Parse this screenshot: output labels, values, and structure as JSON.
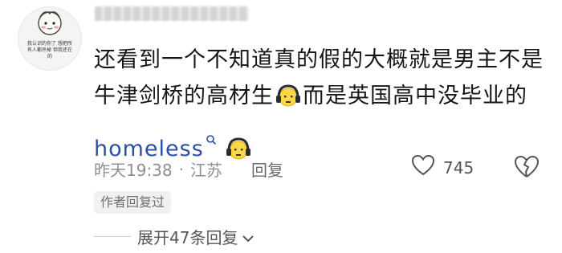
{
  "avatar": {
    "caption": "我认识的你了 想把所有人都杀掉 但我还在的"
  },
  "comment": {
    "text_before": "还看到一个不知道真的假的大概就是男主不是牛津剑桥的高材生",
    "text_middle": "而是英国高中没毕业的",
    "keyword": "homeless",
    "emoji_name": "headphone-face-emoji"
  },
  "meta": {
    "time": "昨天19:38",
    "separator": "·",
    "location": "江苏",
    "reply_label": "回复"
  },
  "likes": {
    "count": "745"
  },
  "author_badge": "作者回复过",
  "expand": {
    "label": "展开47条回复"
  }
}
